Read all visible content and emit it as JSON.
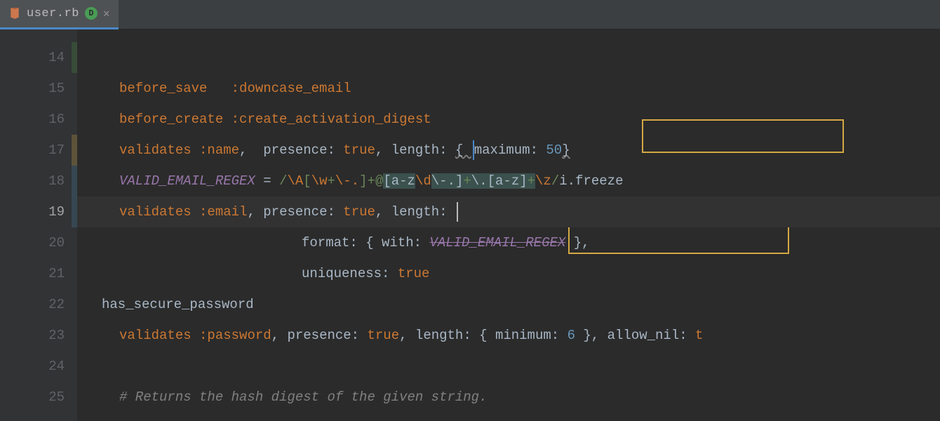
{
  "tab": {
    "filename": "user.rb",
    "badge": "D"
  },
  "lines": {
    "l14": "14",
    "l15": "15",
    "l16": "16",
    "l17": "17",
    "l18": "18",
    "l19": "19",
    "l20": "20",
    "l21": "21",
    "l22": "22",
    "l23": "23",
    "l24": "24",
    "l25": "25"
  },
  "code": {
    "l15_before_save": "before_save   ",
    "l15_sym": ":downcase_email",
    "l16_before_create": "before_create ",
    "l16_sym": ":create_activation_digest",
    "l17_validates": "validates ",
    "l17_name": ":name",
    "l17_comma1": ",  ",
    "l17_presence": "presence: ",
    "l17_true": "true",
    "l17_comma2": ", ",
    "l17_length": "length: ",
    "l17_brace_open": "{ ",
    "l17_maximum": "maximum: ",
    "l17_50": "50",
    "l17_brace_close": "}",
    "l18_const": "VALID_EMAIL_REGEX",
    "l18_eq": " = ",
    "l18_re_open": "/",
    "l18_A": "\\A",
    "l18_b1": "[",
    "l18_w": "\\w",
    "l18_plus1": "+",
    "l18_dot1": "\\-.",
    "l18_b1c": "]",
    "l18_plus2": "+",
    "l18_at": "@",
    "l18_r1": "[a-z",
    "l18_d": "\\d",
    "l18_dot2": "\\-.",
    "l18_r1c": "]",
    "l18_plus3": "+",
    "l18_escdot": "\\.",
    "l18_r2": "[a-z]",
    "l18_plus4": "+",
    "l18_z": "\\z",
    "l18_re_close": "/",
    "l18_i": "i",
    "l18_freeze": ".freeze",
    "l19_validates": "validates ",
    "l19_email": ":email",
    "l19_comma1": ", ",
    "l19_presence": "presence: ",
    "l19_true": "true",
    "l19_comma2": ", ",
    "l19_length": "length: ",
    "l20_format": "format: ",
    "l20_brace_open": "{ ",
    "l20_with": "with: ",
    "l20_const": "VALID_EMAIL_REGEX",
    "l20_brace_close": " }",
    "l20_comma": ",",
    "l21_uniq": "uniqueness: ",
    "l21_true": "true",
    "l22": "has_secure_password",
    "l23_validates": "validates ",
    "l23_password": ":password",
    "l23_comma1": ", ",
    "l23_presence": "presence: ",
    "l23_true1": "true",
    "l23_comma2": ", ",
    "l23_length": "length: ",
    "l23_brace_open": "{ ",
    "l23_minimum": "minimum: ",
    "l23_6": "6",
    "l23_brace_close": " }",
    "l23_comma3": ", ",
    "l23_allow_nil": "allow_nil: ",
    "l23_true2": "t",
    "l25_comment": "# Returns the hash digest of the given string."
  }
}
